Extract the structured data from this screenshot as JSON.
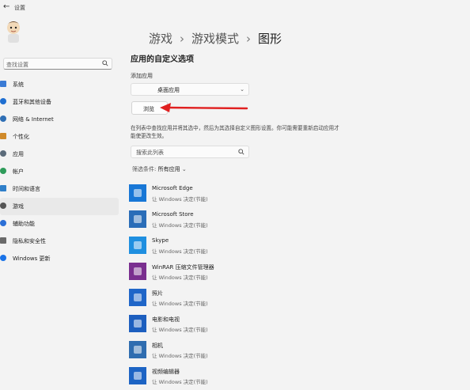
{
  "window": {
    "back_glyph": "←",
    "title": "设置"
  },
  "sidebar": {
    "search_placeholder": "查找设置",
    "items": [
      {
        "label": "系统",
        "icon": "monitor-icon",
        "color": "#3a7bd5"
      },
      {
        "label": "蓝牙和其他设备",
        "icon": "bluetooth-icon",
        "color": "#1f6fd1"
      },
      {
        "label": "网络 & Internet",
        "icon": "wifi-icon",
        "color": "#2f6fb5"
      },
      {
        "label": "个性化",
        "icon": "brush-icon",
        "color": "#d08a2a"
      },
      {
        "label": "应用",
        "icon": "apps-icon",
        "color": "#5b6b7a"
      },
      {
        "label": "帐户",
        "icon": "person-icon",
        "color": "#2e9b5a"
      },
      {
        "label": "时间和语言",
        "icon": "globe-clock-icon",
        "color": "#2f7fc9"
      },
      {
        "label": "游戏",
        "icon": "gamepad-icon",
        "color": "#555555",
        "active": true
      },
      {
        "label": "辅助功能",
        "icon": "accessibility-icon",
        "color": "#2b6fd6"
      },
      {
        "label": "隐私和安全性",
        "icon": "shield-icon",
        "color": "#6a6a6a"
      },
      {
        "label": "Windows 更新",
        "icon": "update-icon",
        "color": "#1a73e8"
      }
    ]
  },
  "breadcrumb": {
    "items": [
      "游戏",
      "游戏模式",
      "图形"
    ],
    "separator": "›"
  },
  "main": {
    "section_title": "应用的自定义选项",
    "add_app_label": "添加应用",
    "dropdown_value": "桌面应用",
    "browse_label": "浏览",
    "description": "在列表中查找应用并将其选中，然后为其选择自定义图形设置。你可能需要重新启动应用才能使更改生效。",
    "list_search_placeholder": "搜索此列表",
    "filter_label": "筛选条件:",
    "filter_value": "所有应用",
    "apps": [
      {
        "name": "Microsoft Edge",
        "sub": "让 Windows 决定(节能)",
        "icon": "edge-icon",
        "color": "#1877d6"
      },
      {
        "name": "Microsoft Store",
        "sub": "让 Windows 决定(节能)",
        "icon": "store-icon",
        "color": "#2a6db8"
      },
      {
        "name": "Skype",
        "sub": "让 Windows 决定(节能)",
        "icon": "skype-icon",
        "color": "#1f8fe0"
      },
      {
        "name": "WinRAR 压缩文件管理器",
        "sub": "让 Windows 决定(节能)",
        "icon": "winrar-icon",
        "color": "#7a2f8f"
      },
      {
        "name": "照片",
        "sub": "让 Windows 决定(节能)",
        "icon": "photos-icon",
        "color": "#1f66c8"
      },
      {
        "name": "电影和电视",
        "sub": "让 Windows 决定(节能)",
        "icon": "movies-icon",
        "color": "#1d5fbf"
      },
      {
        "name": "相机",
        "sub": "让 Windows 决定(节能)",
        "icon": "camera-icon",
        "color": "#2f6db0"
      },
      {
        "name": "视频编辑器",
        "sub": "让 Windows 决定(节能)",
        "icon": "video-editor-icon",
        "color": "#1d64c4"
      }
    ]
  },
  "annotation": {
    "arrow_color": "#e02020"
  }
}
